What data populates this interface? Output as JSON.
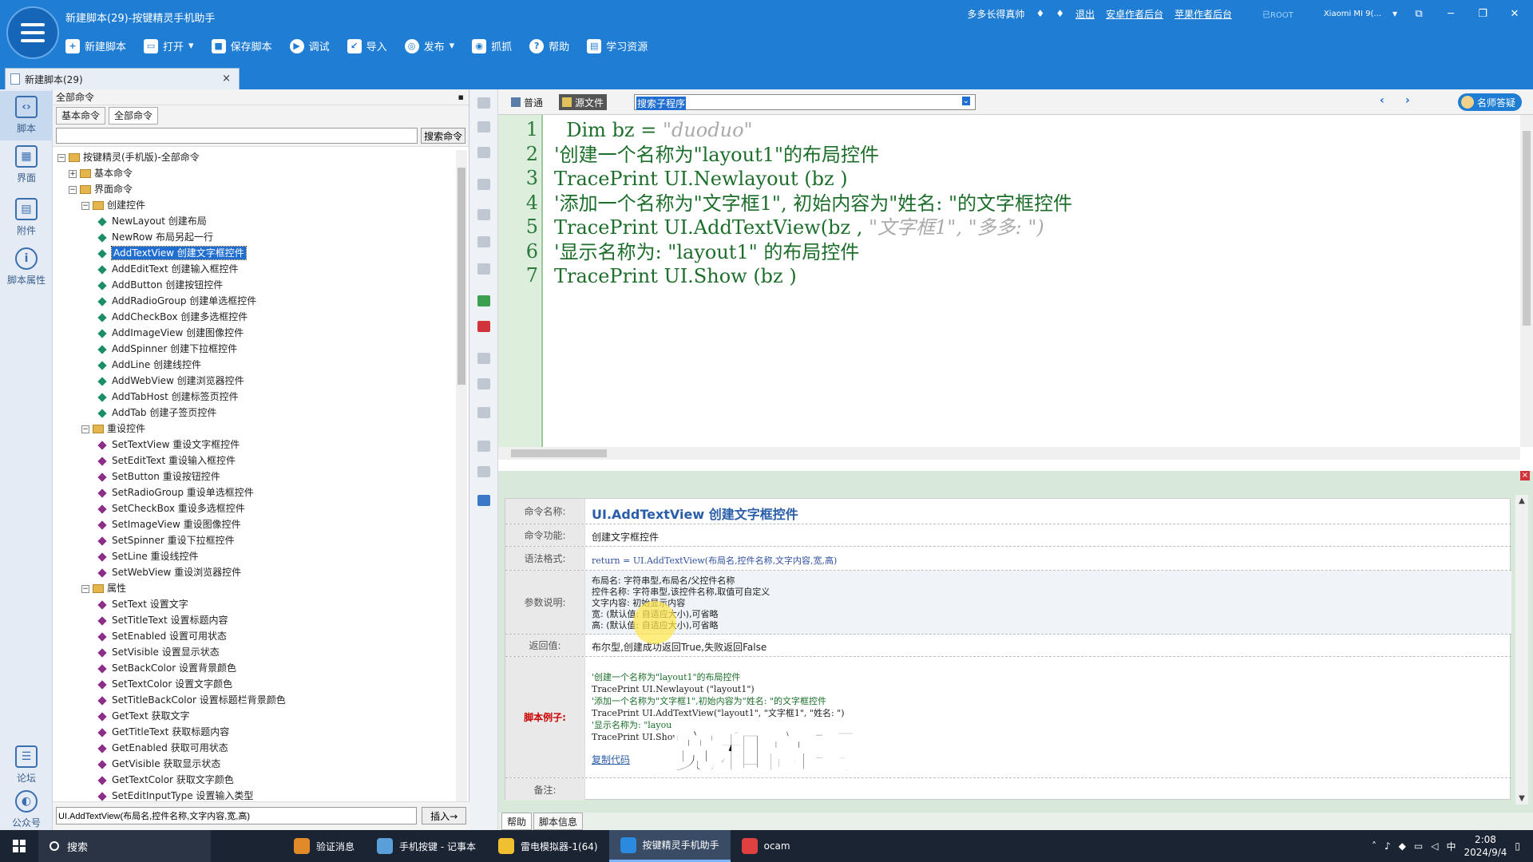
{
  "window": {
    "title": "新建脚本(29)-按键精灵手机助手",
    "user": "多多长得真帅",
    "links": [
      "退出",
      "安卓作者后台",
      "苹果作者后台"
    ],
    "root_badge": "已ROOT",
    "device": "Xiaomi MI 9(..."
  },
  "toolbar": {
    "items": [
      {
        "label": "新建脚本",
        "icon": "plus-icon"
      },
      {
        "label": "打开",
        "icon": "folder-icon"
      },
      {
        "label": "保存脚本",
        "icon": "save-icon"
      },
      {
        "label": "调试",
        "icon": "play-icon"
      },
      {
        "label": "导入",
        "icon": "import-icon"
      },
      {
        "label": "发布",
        "icon": "publish-icon"
      },
      {
        "label": "抓抓",
        "icon": "camera-icon"
      },
      {
        "label": "帮助",
        "icon": "help-icon"
      },
      {
        "label": "学习资源",
        "icon": "book-icon"
      }
    ]
  },
  "doc_tab": {
    "label": "新建脚本(29)",
    "close": "×"
  },
  "rail": {
    "items": [
      "脚本",
      "界面",
      "附件",
      "脚本属性"
    ],
    "bottom": [
      "论坛",
      "公众号"
    ]
  },
  "commands": {
    "header": "全部命令",
    "tabs": [
      "基本命令",
      "全部命令"
    ],
    "search_button": "搜索命令",
    "search_value": "",
    "root": "按键精灵(手机版)-全部命令",
    "tree": [
      {
        "level": 1,
        "type": "folder",
        "exp": "+",
        "label": "基本命令"
      },
      {
        "level": 1,
        "type": "folder",
        "exp": "−",
        "label": "界面命令"
      },
      {
        "level": 2,
        "type": "group",
        "exp": "−",
        "label": "创建控件"
      },
      {
        "level": 3,
        "type": "item",
        "label": "NewLayout 创建布局"
      },
      {
        "level": 3,
        "type": "item",
        "label": "NewRow 布局另起一行"
      },
      {
        "level": 3,
        "type": "item",
        "label": "AddTextView 创建文字框控件",
        "selected": true
      },
      {
        "level": 3,
        "type": "item",
        "label": "AddEditText 创建输入框控件"
      },
      {
        "level": 3,
        "type": "item",
        "label": "AddButton 创建按钮控件"
      },
      {
        "level": 3,
        "type": "item",
        "label": "AddRadioGroup 创建单选框控件"
      },
      {
        "level": 3,
        "type": "item",
        "label": "AddCheckBox 创建多选框控件"
      },
      {
        "level": 3,
        "type": "item",
        "label": "AddImageView 创建图像控件"
      },
      {
        "level": 3,
        "type": "item",
        "label": "AddSpinner 创建下拉框控件"
      },
      {
        "level": 3,
        "type": "item",
        "label": "AddLine 创建线控件"
      },
      {
        "level": 3,
        "type": "item",
        "label": "AddWebView 创建浏览器控件"
      },
      {
        "level": 3,
        "type": "item",
        "label": "AddTabHost 创建标签页控件"
      },
      {
        "level": 3,
        "type": "item",
        "label": "AddTab 创建子签页控件"
      },
      {
        "level": 2,
        "type": "group",
        "exp": "−",
        "label": "重设控件"
      },
      {
        "level": 3,
        "type": "item2",
        "label": "SetTextView 重设文字框控件"
      },
      {
        "level": 3,
        "type": "item2",
        "label": "SetEditText 重设输入框控件"
      },
      {
        "level": 3,
        "type": "item2",
        "label": "SetButton 重设按钮控件"
      },
      {
        "level": 3,
        "type": "item2",
        "label": "SetRadioGroup 重设单选框控件"
      },
      {
        "level": 3,
        "type": "item2",
        "label": "SetCheckBox 重设多选框控件"
      },
      {
        "level": 3,
        "type": "item2",
        "label": "SetImageView 重设图像控件"
      },
      {
        "level": 3,
        "type": "item2",
        "label": "SetSpinner 重设下拉框控件"
      },
      {
        "level": 3,
        "type": "item2",
        "label": "SetLine 重设线控件"
      },
      {
        "level": 3,
        "type": "item2",
        "label": "SetWebView 重设浏览器控件"
      },
      {
        "level": 2,
        "type": "group",
        "exp": "−",
        "label": "属性"
      },
      {
        "level": 3,
        "type": "item2",
        "label": "SetText 设置文字"
      },
      {
        "level": 3,
        "type": "item2",
        "label": "SetTitleText 设置标题内容"
      },
      {
        "level": 3,
        "type": "item2",
        "label": "SetEnabled 设置可用状态"
      },
      {
        "level": 3,
        "type": "item2",
        "label": "SetVisible 设置显示状态"
      },
      {
        "level": 3,
        "type": "item2",
        "label": "SetBackColor 设置背景颜色"
      },
      {
        "level": 3,
        "type": "item2",
        "label": "SetTextColor 设置文字颜色"
      },
      {
        "level": 3,
        "type": "item2",
        "label": "SetTitleBackColor 设置标题栏背景颜色"
      },
      {
        "level": 3,
        "type": "item2",
        "label": "GetText 获取文字"
      },
      {
        "level": 3,
        "type": "item2",
        "label": "GetTitleText 获取标题内容"
      },
      {
        "level": 3,
        "type": "item2",
        "label": "GetEnabled 获取可用状态"
      },
      {
        "level": 3,
        "type": "item2",
        "label": "GetVisible 获取显示状态"
      },
      {
        "level": 3,
        "type": "item2",
        "label": "GetTextColor 获取文字颜色"
      },
      {
        "level": 3,
        "type": "item2",
        "label": "SetEditInputType 设置输入类型"
      }
    ],
    "bottom_value": "UI.AddTextView(布局名,控件名称,文字内容,宽,高)",
    "insert_button": "插入→"
  },
  "editor": {
    "mode_normal": "普通",
    "mode_source": "源文件",
    "sub_search": "搜索子程序",
    "teacher": "名师答疑",
    "lines": [
      {
        "n": "1",
        "code": "  Dim bz = ",
        "str": "\"duoduo\""
      },
      {
        "n": "2",
        "code": "'创建一个名称为\"layout1\"的布局控件",
        "str": ""
      },
      {
        "n": "3",
        "code": "TracePrint UI.Newlayout (bz )",
        "str": ""
      },
      {
        "n": "4",
        "code": "'添加一个名称为\"文字框1\", 初始内容为\"姓名: \"的文字框控件",
        "str": ""
      },
      {
        "n": "5",
        "code": "TracePrint UI.AddTextView(bz , ",
        "str": "\"文字框1\", \"多多: \")"
      },
      {
        "n": "6",
        "code": "'显示名称为: \"layout1\" 的布局控件",
        "str": ""
      },
      {
        "n": "7",
        "code": "TracePrint UI.Show (bz )",
        "str": ""
      }
    ]
  },
  "info": {
    "name_label": "命令名称:",
    "name_value": "UI.AddTextView 创建文字框控件",
    "func_label": "命令功能:",
    "func_value": "创建文字框控件",
    "syntax_label": "语法格式:",
    "syntax_value": "return = UI.AddTextView(布局名,控件名称,文字内容,宽,高)",
    "param_label": "参数说明:",
    "params": [
      "布局名: 字符串型,布局名/父控件名称",
      "控件名称: 字符串型,该控件名称,取值可自定义",
      "文字内容: 初始显示内容",
      "宽: (默认值: 自适应大小),可省略",
      "高: (默认值: 自适应大小),可省略"
    ],
    "return_label": "返回值:",
    "return_value": "布尔型,创建成功返回True,失败返回False",
    "example_label": "脚本例子:",
    "example": [
      "'创建一个名称为\"layout1\"的布局控件",
      "TracePrint UI.Newlayout (\"layout1\")",
      "'添加一个名称为\"文字框1\",初始内容为\"姓名: \"的文字框控件",
      "TracePrint UI.AddTextView(\"layout1\", \"文字框1\", \"姓名: \")",
      "'显示名称为: \"layou",
      "TracePrint UI.Show"
    ],
    "copy_link": "复制代码",
    "note_label": "备注:",
    "bottom_tabs": [
      "帮助",
      "脚本信息"
    ]
  },
  "caption": "宽和高啊",
  "taskbar": {
    "search": "搜索",
    "apps": [
      {
        "label": "验证消息",
        "color": "#e08a2a"
      },
      {
        "label": "手机按键 - 记事本",
        "color": "#5aa0d8"
      },
      {
        "label": "雷电模拟器-1(64)",
        "color": "#f0c030"
      },
      {
        "label": "按键精灵手机助手",
        "color": "#2a8ae0",
        "active": true
      },
      {
        "label": "ocam",
        "color": "#e04040"
      }
    ],
    "ime": "中",
    "time": "2:08",
    "date": "2024/9/4"
  }
}
